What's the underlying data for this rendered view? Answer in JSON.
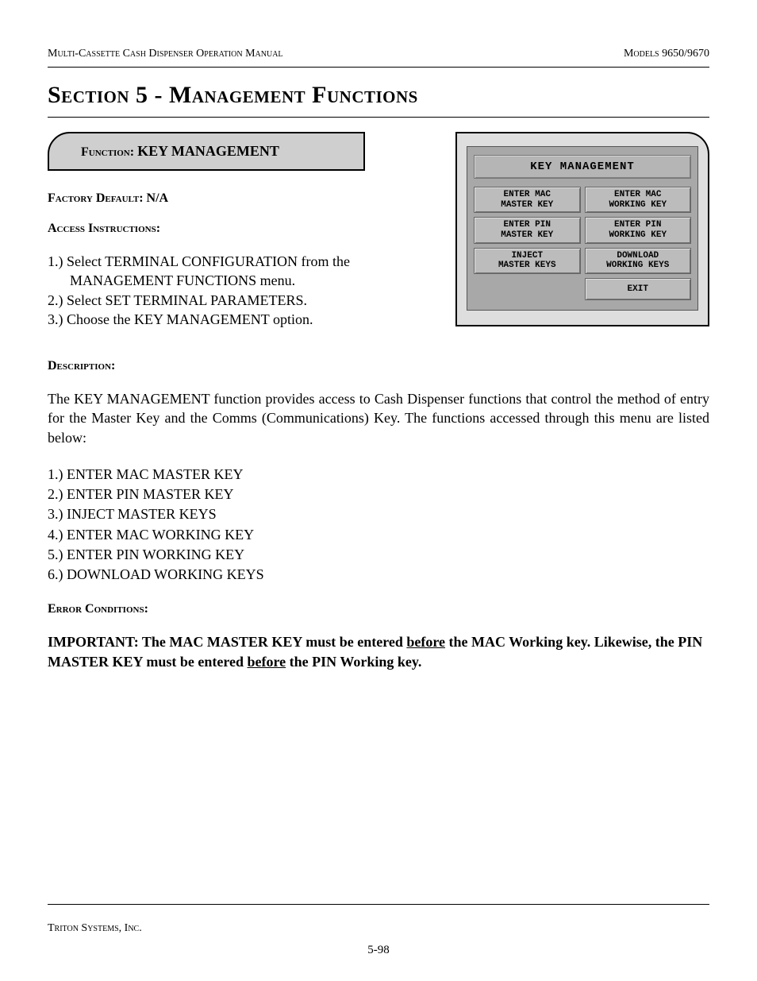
{
  "header": {
    "left": "Multi-Cassette Cash Dispenser Operation Manual",
    "right": "Models 9650/9670"
  },
  "section_title": "Section 5 - Management Functions",
  "function_box": {
    "label": "Function:",
    "name": "KEY MANAGEMENT"
  },
  "factory_default": {
    "label": "Factory Default:",
    "value": "N/A"
  },
  "access": {
    "label": "Access Instructions:",
    "items": [
      "1.) Select TERMINAL CONFIGURATION from the MANAGEMENT FUNCTIONS menu.",
      "2.) Select SET TERMINAL PARAMETERS.",
      "3.) Choose the KEY MANAGEMENT option."
    ]
  },
  "terminal": {
    "title": "KEY MANAGEMENT",
    "buttons": [
      "ENTER MAC\nMASTER KEY",
      "ENTER MAC\nWORKING KEY",
      "ENTER PIN\nMASTER KEY",
      "ENTER PIN\nWORKING KEY",
      "INJECT\nMASTER KEYS",
      "DOWNLOAD\nWORKING KEYS",
      "",
      "EXIT"
    ]
  },
  "description": {
    "label": "Description:",
    "text": "The KEY MANAGEMENT function provides access to Cash Dispenser functions that control the method of entry for the Master Key and the Comms (Communications) Key.  The functions accessed through this menu are listed below:",
    "items": [
      "1.) ENTER MAC MASTER KEY",
      "2.) ENTER PIN MASTER KEY",
      "3.) INJECT MASTER KEYS",
      "4.) ENTER MAC WORKING KEY",
      "5.) ENTER PIN WORKING  KEY",
      "6.) DOWNLOAD WORKING KEYS"
    ]
  },
  "error": {
    "label": "Error Conditions:",
    "p1a": "IMPORTANT: The MAC MASTER KEY must be entered ",
    "p1u": "before",
    "p1b": " the MAC Working key. Likewise, the PIN MASTER KEY must be entered ",
    "p2u": "before",
    "p2b": " the PIN Working key."
  },
  "footer": {
    "company": "Triton Systems, Inc.",
    "page": "5-98"
  }
}
